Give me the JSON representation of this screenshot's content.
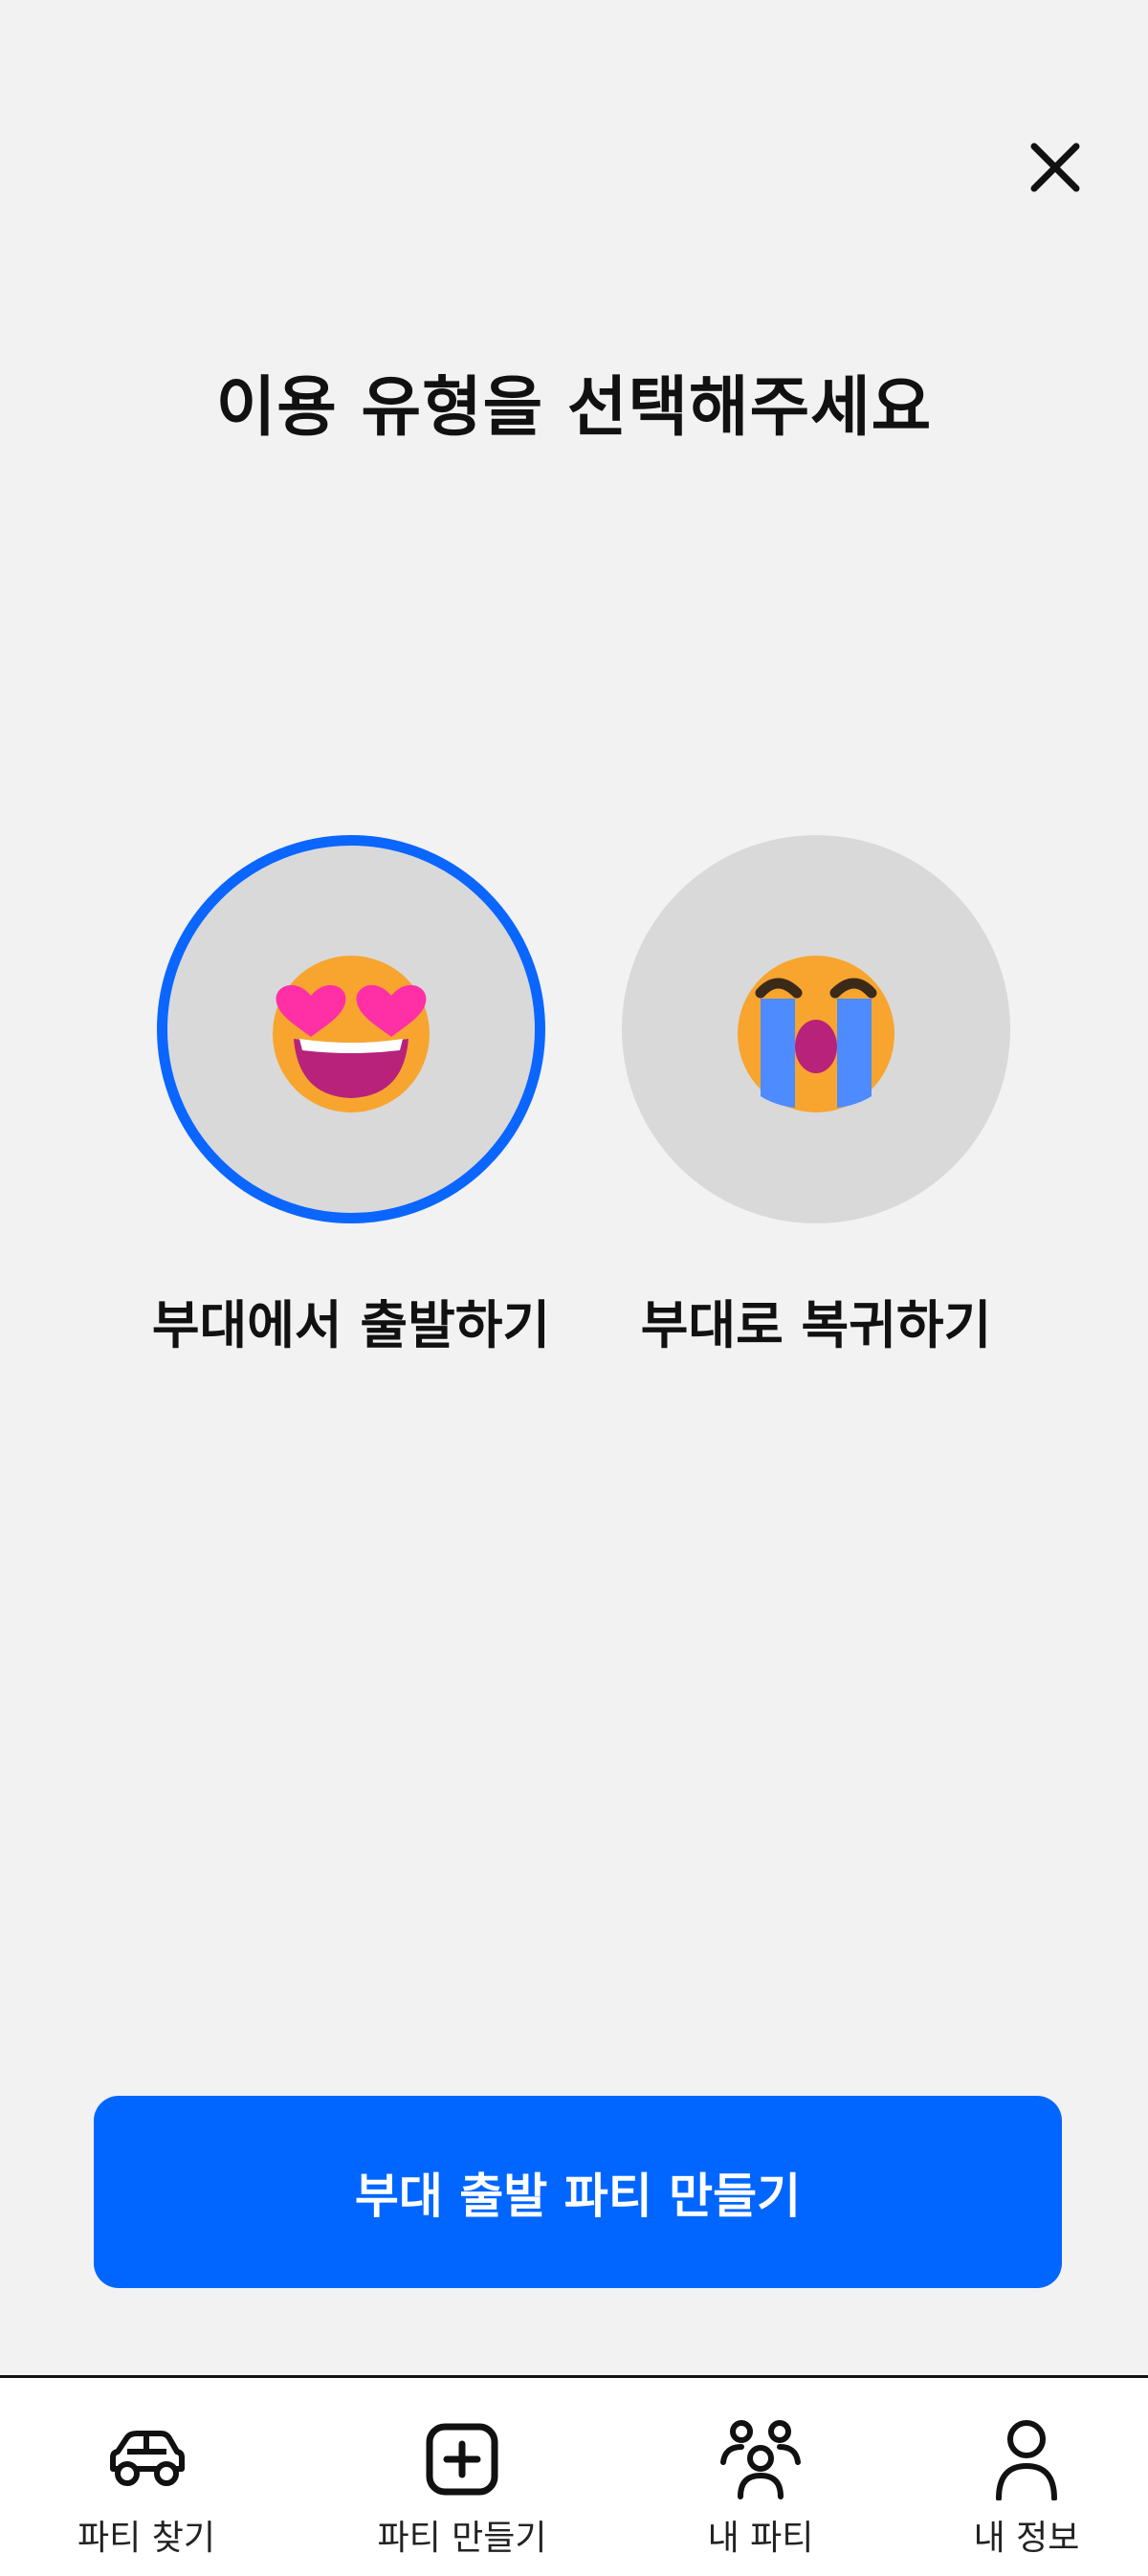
{
  "header": {
    "close_icon": "close-icon"
  },
  "title": "이용 유형을 선택해주세요",
  "options": [
    {
      "label": "부대에서 출발하기",
      "icon": "heart-eyes-emoji-icon",
      "selected": true
    },
    {
      "label": "부대로 복귀하기",
      "icon": "loudly-crying-emoji-icon",
      "selected": false
    }
  ],
  "cta": {
    "label": "부대 출발 파티 만들기"
  },
  "colors": {
    "accent": "#0066ff",
    "background": "#f2f2f3",
    "circle": "#d9d9da"
  },
  "tabbar": {
    "items": [
      {
        "label": "파티 찾기",
        "icon": "car-icon"
      },
      {
        "label": "파티 만들기",
        "icon": "plus-square-icon"
      },
      {
        "label": "내 파티",
        "icon": "group-icon"
      },
      {
        "label": "내 정보",
        "icon": "person-icon"
      }
    ]
  }
}
